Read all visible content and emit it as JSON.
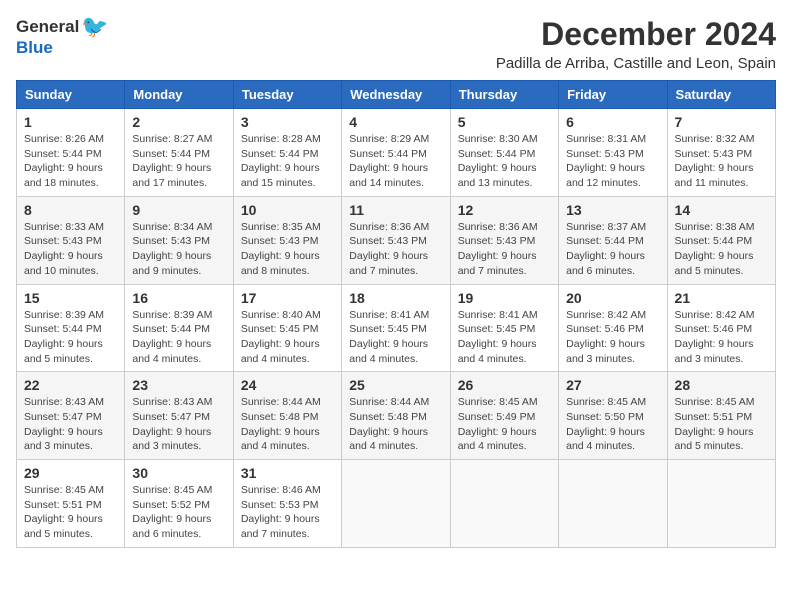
{
  "header": {
    "logo_general": "General",
    "logo_blue": "Blue",
    "month_title": "December 2024",
    "location": "Padilla de Arriba, Castille and Leon, Spain"
  },
  "weekdays": [
    "Sunday",
    "Monday",
    "Tuesday",
    "Wednesday",
    "Thursday",
    "Friday",
    "Saturday"
  ],
  "weeks": [
    [
      {
        "day": "1",
        "sunrise": "8:26 AM",
        "sunset": "5:44 PM",
        "daylight": "9 hours and 18 minutes."
      },
      {
        "day": "2",
        "sunrise": "8:27 AM",
        "sunset": "5:44 PM",
        "daylight": "9 hours and 17 minutes."
      },
      {
        "day": "3",
        "sunrise": "8:28 AM",
        "sunset": "5:44 PM",
        "daylight": "9 hours and 15 minutes."
      },
      {
        "day": "4",
        "sunrise": "8:29 AM",
        "sunset": "5:44 PM",
        "daylight": "9 hours and 14 minutes."
      },
      {
        "day": "5",
        "sunrise": "8:30 AM",
        "sunset": "5:44 PM",
        "daylight": "9 hours and 13 minutes."
      },
      {
        "day": "6",
        "sunrise": "8:31 AM",
        "sunset": "5:43 PM",
        "daylight": "9 hours and 12 minutes."
      },
      {
        "day": "7",
        "sunrise": "8:32 AM",
        "sunset": "5:43 PM",
        "daylight": "9 hours and 11 minutes."
      }
    ],
    [
      {
        "day": "8",
        "sunrise": "8:33 AM",
        "sunset": "5:43 PM",
        "daylight": "9 hours and 10 minutes."
      },
      {
        "day": "9",
        "sunrise": "8:34 AM",
        "sunset": "5:43 PM",
        "daylight": "9 hours and 9 minutes."
      },
      {
        "day": "10",
        "sunrise": "8:35 AM",
        "sunset": "5:43 PM",
        "daylight": "9 hours and 8 minutes."
      },
      {
        "day": "11",
        "sunrise": "8:36 AM",
        "sunset": "5:43 PM",
        "daylight": "9 hours and 7 minutes."
      },
      {
        "day": "12",
        "sunrise": "8:36 AM",
        "sunset": "5:43 PM",
        "daylight": "9 hours and 7 minutes."
      },
      {
        "day": "13",
        "sunrise": "8:37 AM",
        "sunset": "5:44 PM",
        "daylight": "9 hours and 6 minutes."
      },
      {
        "day": "14",
        "sunrise": "8:38 AM",
        "sunset": "5:44 PM",
        "daylight": "9 hours and 5 minutes."
      }
    ],
    [
      {
        "day": "15",
        "sunrise": "8:39 AM",
        "sunset": "5:44 PM",
        "daylight": "9 hours and 5 minutes."
      },
      {
        "day": "16",
        "sunrise": "8:39 AM",
        "sunset": "5:44 PM",
        "daylight": "9 hours and 4 minutes."
      },
      {
        "day": "17",
        "sunrise": "8:40 AM",
        "sunset": "5:45 PM",
        "daylight": "9 hours and 4 minutes."
      },
      {
        "day": "18",
        "sunrise": "8:41 AM",
        "sunset": "5:45 PM",
        "daylight": "9 hours and 4 minutes."
      },
      {
        "day": "19",
        "sunrise": "8:41 AM",
        "sunset": "5:45 PM",
        "daylight": "9 hours and 4 minutes."
      },
      {
        "day": "20",
        "sunrise": "8:42 AM",
        "sunset": "5:46 PM",
        "daylight": "9 hours and 3 minutes."
      },
      {
        "day": "21",
        "sunrise": "8:42 AM",
        "sunset": "5:46 PM",
        "daylight": "9 hours and 3 minutes."
      }
    ],
    [
      {
        "day": "22",
        "sunrise": "8:43 AM",
        "sunset": "5:47 PM",
        "daylight": "9 hours and 3 minutes."
      },
      {
        "day": "23",
        "sunrise": "8:43 AM",
        "sunset": "5:47 PM",
        "daylight": "9 hours and 3 minutes."
      },
      {
        "day": "24",
        "sunrise": "8:44 AM",
        "sunset": "5:48 PM",
        "daylight": "9 hours and 4 minutes."
      },
      {
        "day": "25",
        "sunrise": "8:44 AM",
        "sunset": "5:48 PM",
        "daylight": "9 hours and 4 minutes."
      },
      {
        "day": "26",
        "sunrise": "8:45 AM",
        "sunset": "5:49 PM",
        "daylight": "9 hours and 4 minutes."
      },
      {
        "day": "27",
        "sunrise": "8:45 AM",
        "sunset": "5:50 PM",
        "daylight": "9 hours and 4 minutes."
      },
      {
        "day": "28",
        "sunrise": "8:45 AM",
        "sunset": "5:51 PM",
        "daylight": "9 hours and 5 minutes."
      }
    ],
    [
      {
        "day": "29",
        "sunrise": "8:45 AM",
        "sunset": "5:51 PM",
        "daylight": "9 hours and 5 minutes."
      },
      {
        "day": "30",
        "sunrise": "8:45 AM",
        "sunset": "5:52 PM",
        "daylight": "9 hours and 6 minutes."
      },
      {
        "day": "31",
        "sunrise": "8:46 AM",
        "sunset": "5:53 PM",
        "daylight": "9 hours and 7 minutes."
      },
      null,
      null,
      null,
      null
    ]
  ],
  "labels": {
    "sunrise": "Sunrise:",
    "sunset": "Sunset:",
    "daylight": "Daylight:"
  }
}
